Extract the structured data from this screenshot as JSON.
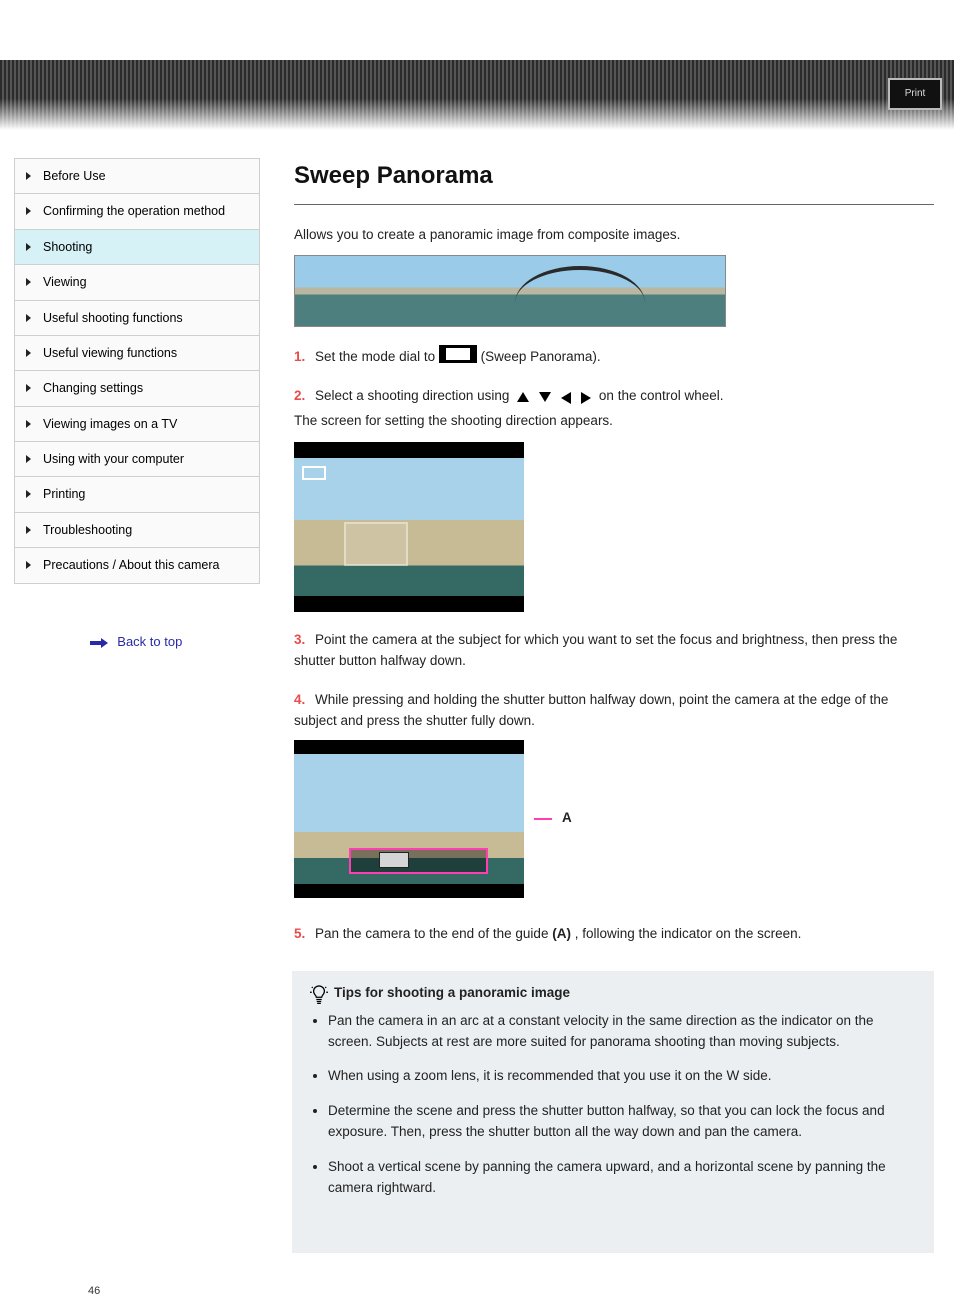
{
  "header": {
    "box_label": "Print"
  },
  "sidebar": {
    "items": [
      {
        "label": "Before Use"
      },
      {
        "label": "Confirming the operation method"
      },
      {
        "label": "Shooting"
      },
      {
        "label": "Viewing"
      },
      {
        "label": "Useful shooting functions"
      },
      {
        "label": "Useful viewing functions"
      },
      {
        "label": "Changing settings"
      },
      {
        "label": "Viewing images on a TV"
      },
      {
        "label": "Using with your computer"
      },
      {
        "label": "Printing"
      },
      {
        "label": "Troubleshooting"
      },
      {
        "label": "Precautions / About this camera"
      }
    ],
    "back_label": "Back to top"
  },
  "content": {
    "title": "Sweep Panorama",
    "intro_text": "Allows you to create a panoramic image from composite images.",
    "step1": {
      "num": "1.",
      "pre": "Set the mode dial to ",
      "post": " (Sweep Panorama)."
    },
    "step2": {
      "num": "2.",
      "pre": "Select a shooting direction using ",
      "post": " on the control wheel.",
      "caption": "The screen for setting the shooting direction appears."
    },
    "step3": {
      "num": "3.",
      "text": "Point the camera at the subject for which you want to set the focus and brightness, then press the shutter button halfway down."
    },
    "step4": {
      "num": "4.",
      "text": "While pressing and holding the shutter button halfway down, point the camera at the edge of the subject and press the shutter fully down."
    },
    "step5": {
      "num": "5.",
      "pre": "Pan the camera to the end of the guide ",
      "bold": "(A)",
      "post": ", following the indicator on the screen.",
      "marker": "A"
    },
    "tips": {
      "heading": "Tips for shooting a panoramic image",
      "items": [
        "Pan the camera in an arc at a constant velocity in the same direction as the indicator on the screen. Subjects at rest are more suited for panorama shooting than moving subjects.",
        "When using a zoom lens, it is recommended that you use it on the W side.",
        "Determine the scene and press the shutter button halfway, so that you can lock the focus and exposure. Then, press the shutter button all the way down and pan the camera.",
        "Shoot a vertical scene by panning the camera upward, and a horizontal scene by panning the camera rightward."
      ]
    }
  },
  "page_number": "46"
}
